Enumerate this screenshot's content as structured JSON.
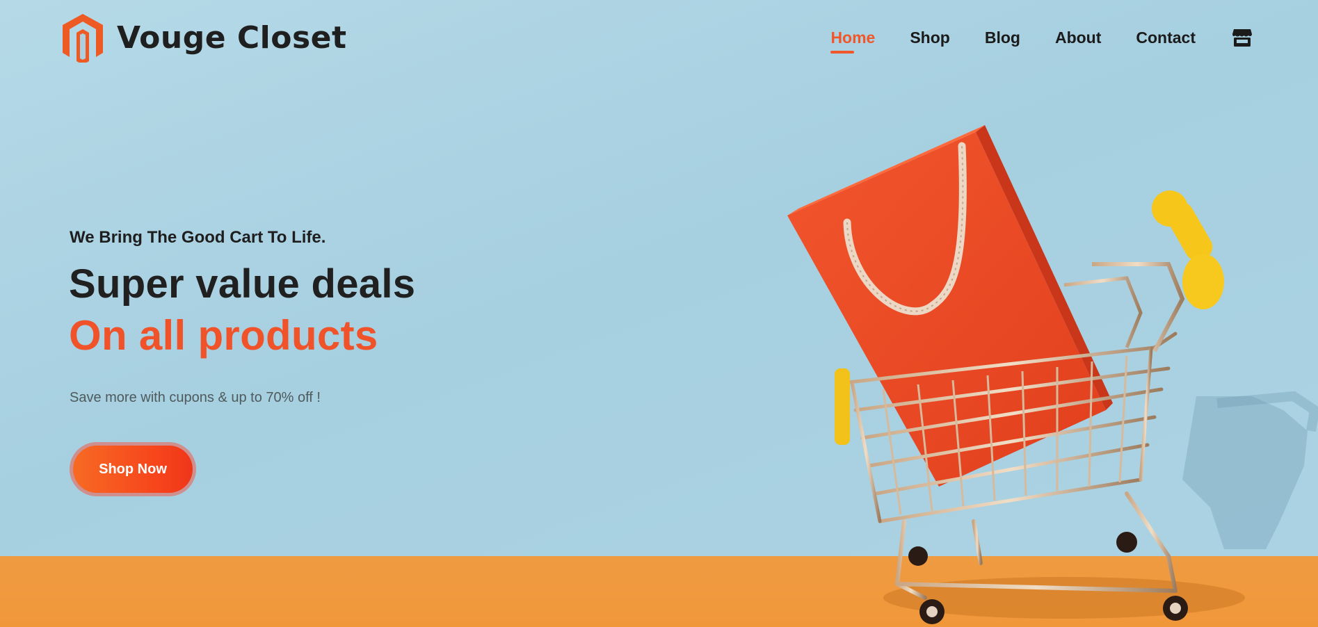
{
  "brand": {
    "name": "Vouge Closet",
    "accent_color": "#f0582b"
  },
  "nav": {
    "items": [
      {
        "label": "Home",
        "active": true
      },
      {
        "label": "Shop",
        "active": false
      },
      {
        "label": "Blog",
        "active": false
      },
      {
        "label": "About",
        "active": false
      },
      {
        "label": "Contact",
        "active": false
      }
    ],
    "cart_icon": "store-icon"
  },
  "hero": {
    "tagline": "We Bring The Good Cart To Life.",
    "headline_primary": "Super value deals",
    "headline_accent": "On all products",
    "subtext": "Save more with cupons & up to 70% off !",
    "cta_label": "Shop Now",
    "image": "red shopping bag in a miniature shopping cart"
  }
}
